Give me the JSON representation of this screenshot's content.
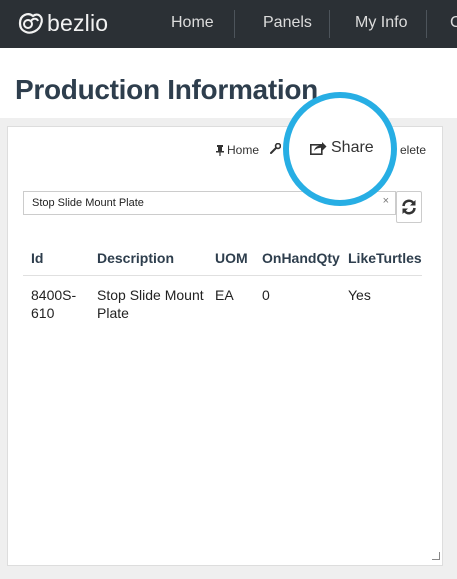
{
  "navbar": {
    "brand": "bezlio",
    "items": [
      "Home",
      "Panels",
      "My Info",
      "C"
    ]
  },
  "page": {
    "title": "Production Information"
  },
  "toolbar": {
    "home_label": "Home",
    "share_label": "Share",
    "delete_label": "elete"
  },
  "search": {
    "value": "Stop Slide Mount Plate",
    "clear_label": "×"
  },
  "table": {
    "headers": [
      "Id",
      "Description",
      "UOM",
      "OnHandQty",
      "LikeTurtles"
    ],
    "rows": [
      {
        "id_line1": "8400S-",
        "id_line2": "610",
        "desc_line1": "Stop Slide Mount",
        "desc_line2": "Plate",
        "uom": "EA",
        "qty": "0",
        "turtles": "Yes"
      }
    ]
  },
  "colors": {
    "navbar": "#2b3035",
    "title": "#2e3e4d",
    "highlight_ring": "#27aee4"
  },
  "icons": [
    "bezlio-logo-icon",
    "pin-icon",
    "wrench-icon",
    "share-icon",
    "refresh-icon",
    "resize-grip-icon"
  ]
}
